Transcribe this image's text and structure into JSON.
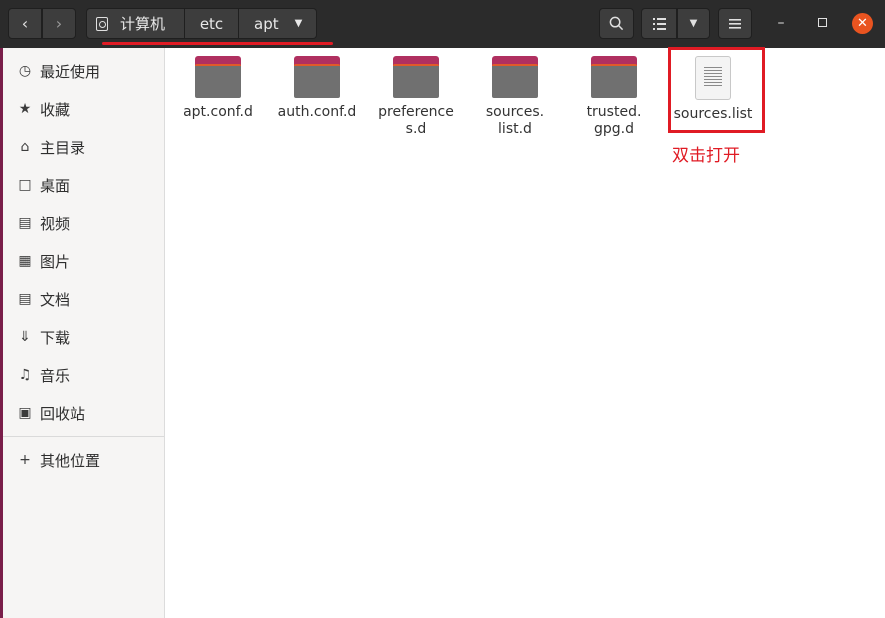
{
  "titlebar": {
    "breadcrumbs": [
      "计算机",
      "etc",
      "apt"
    ],
    "underline_color": "#e01b24"
  },
  "sidebar": {
    "items": [
      {
        "icon": "clock-icon",
        "label": "最近使用"
      },
      {
        "icon": "star-icon",
        "label": "收藏"
      },
      {
        "icon": "home-icon",
        "label": "主目录"
      },
      {
        "icon": "desktop-icon",
        "label": "桌面"
      },
      {
        "icon": "video-icon",
        "label": "视频"
      },
      {
        "icon": "image-icon",
        "label": "图片"
      },
      {
        "icon": "document-icon",
        "label": "文档"
      },
      {
        "icon": "download-icon",
        "label": "下载"
      },
      {
        "icon": "music-icon",
        "label": "音乐"
      },
      {
        "icon": "trash-icon",
        "label": "回收站"
      }
    ],
    "other_locations": {
      "icon": "plus-icon",
      "label": "其他位置"
    }
  },
  "files": [
    {
      "type": "folder",
      "name": "apt.conf.d"
    },
    {
      "type": "folder",
      "name": "auth.conf.d"
    },
    {
      "type": "folder",
      "name": "preferences.d"
    },
    {
      "type": "folder",
      "name": "sources.list.d"
    },
    {
      "type": "folder",
      "name": "trusted.gpg.d"
    },
    {
      "type": "file",
      "name": "sources.list"
    }
  ],
  "annotation": {
    "text": "双击打开",
    "color": "#e01b24"
  },
  "colors": {
    "accent": "#e95420",
    "titlebar": "#2b2b2b",
    "highlight": "#e01b24"
  }
}
